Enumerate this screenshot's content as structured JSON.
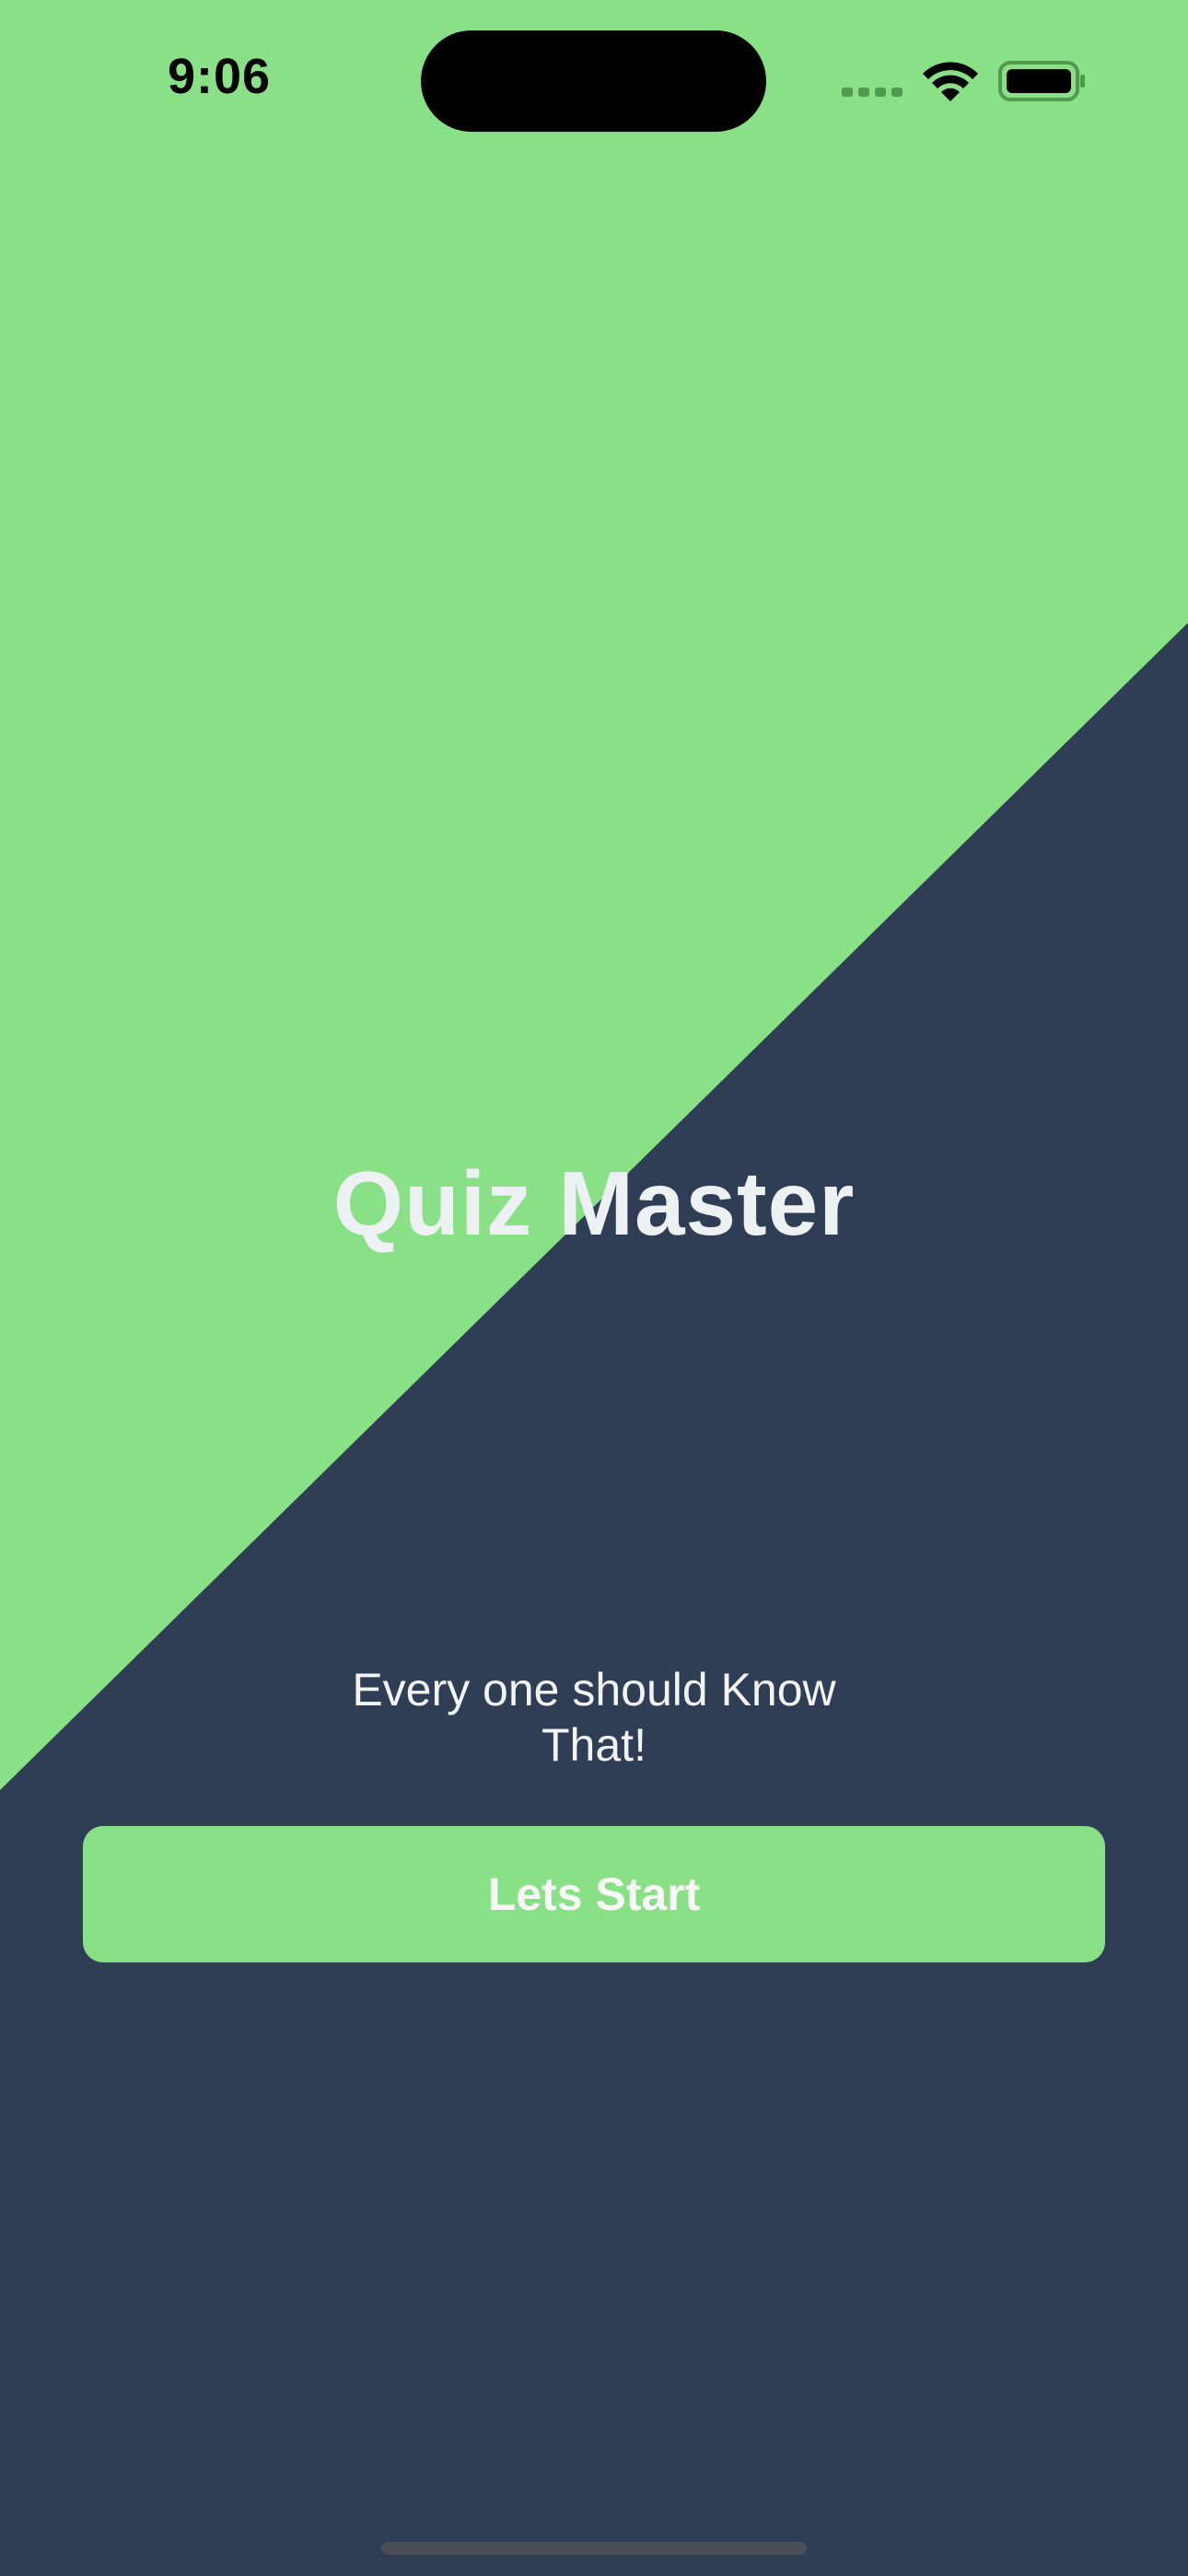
{
  "status_bar": {
    "time": "9:06",
    "icons": [
      "cellular-signal-icon",
      "wifi-icon",
      "battery-icon"
    ]
  },
  "main": {
    "title": "Quiz Master",
    "subtitle_line1": "Every one should Know",
    "subtitle_line2": "That!",
    "start_button_label": "Lets Start"
  },
  "colors": {
    "green": "#8ae086",
    "navy": "#2f3d55",
    "text_light": "#eef1f4"
  }
}
